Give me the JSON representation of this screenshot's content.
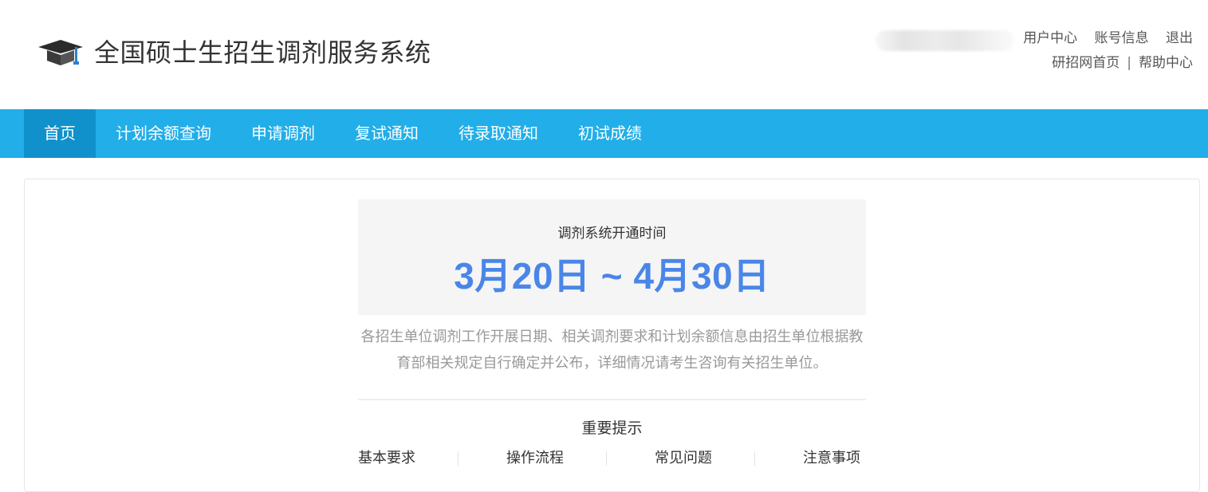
{
  "header": {
    "title": "全国硕士生招生调剂服务系统",
    "logo_icon": "graduation-cap-icon",
    "user_links": [
      "用户中心",
      "账号信息",
      "退出"
    ],
    "site_links": [
      "研招网首页",
      "帮助中心"
    ],
    "site_links_separator": "|"
  },
  "nav": {
    "items": [
      {
        "label": "首页",
        "active": true
      },
      {
        "label": "计划余额查询",
        "active": false
      },
      {
        "label": "申请调剂",
        "active": false
      },
      {
        "label": "复试通知",
        "active": false
      },
      {
        "label": "待录取通知",
        "active": false
      },
      {
        "label": "初试成绩",
        "active": false
      }
    ]
  },
  "main": {
    "open_time_label": "调剂系统开通时间",
    "open_time_range": "3月20日 ~ 4月30日",
    "notice": "各招生单位调剂工作开展日期、相关调剂要求和计划余额信息由招生单位根据教育部相关规定自行确定并公布，详细情况请考生咨询有关招生单位。",
    "tips_title": "重要提示",
    "tips_links": [
      "基本要求",
      "操作流程",
      "常见问题",
      "注意事项"
    ]
  },
  "colors": {
    "nav_bg": "#22aee8",
    "nav_active_bg": "#1191cc",
    "date_accent": "#4a86e8",
    "title_text": "#333333",
    "notice_text": "#999999"
  }
}
